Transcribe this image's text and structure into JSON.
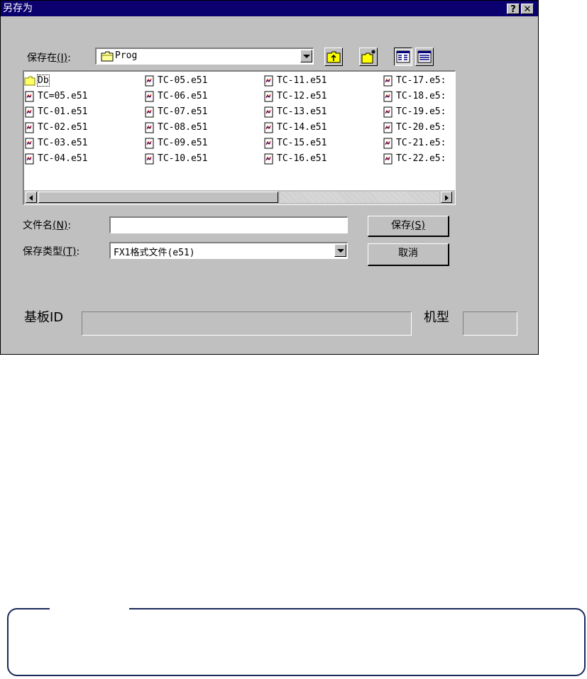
{
  "dialog": {
    "title": "另存为",
    "help_button": "?",
    "close_button": "✕",
    "save_in": {
      "label": "保存在",
      "hotkey": "(I)",
      "colon": ":",
      "value": "Prog"
    },
    "files": [
      [
        "Db",
        "TC=05.e51",
        "TC-01.e51",
        "TC-02.e51",
        "TC-03.e51",
        "TC-04.e51"
      ],
      [
        "TC-05.e51",
        "TC-06.e51",
        "TC-07.e51",
        "TC-08.e51",
        "TC-09.e51",
        "TC-10.e51"
      ],
      [
        "TC-11.e51",
        "TC-12.e51",
        "TC-13.e51",
        "TC-14.e51",
        "TC-15.e51",
        "TC-16.e51"
      ],
      [
        "TC-17.e5:",
        "TC-18.e5:",
        "TC-19.e5:",
        "TC-20.e5:",
        "TC-21.e5:",
        "TC-22.e5:"
      ]
    ],
    "filename": {
      "label": "文件名",
      "hotkey": "(N)",
      "colon": ":",
      "value": ""
    },
    "filetype": {
      "label": "保存类型",
      "hotkey": "(T)",
      "colon": ":",
      "value": "FX1格式文件(e51)"
    },
    "save_button": {
      "label": "保存",
      "hotkey": "(S)"
    },
    "cancel_button": "取消",
    "board_id": {
      "label": "基板ID",
      "value": ""
    },
    "model": {
      "label": "机型",
      "value": ""
    }
  },
  "colors": {
    "title_bar": "#0a006e",
    "dialog_bg": "#c0c0c0",
    "note_border": "#1a2a5a"
  },
  "icons": [
    "help-icon",
    "close-icon",
    "folder-icon",
    "up-folder-icon",
    "new-folder-icon",
    "list-view-icon",
    "details-view-icon",
    "file-icon"
  ]
}
